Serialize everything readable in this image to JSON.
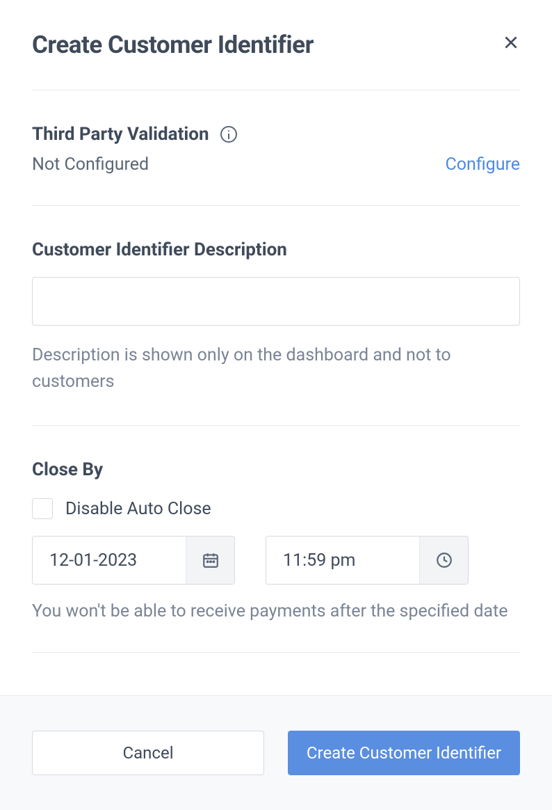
{
  "header": {
    "title": "Create Customer Identifier"
  },
  "validation": {
    "label": "Third Party Validation",
    "status": "Not Configured",
    "configure_link": "Configure"
  },
  "description": {
    "label": "Customer Identifier Description",
    "value": "",
    "helper": "Description is shown only on the dashboard and not to customers"
  },
  "close_by": {
    "label": "Close By",
    "checkbox_label": "Disable Auto Close",
    "date_value": "12-01-2023",
    "time_value": "11:59 pm",
    "helper": "You won't be able to receive payments after the specified date"
  },
  "footer": {
    "cancel_label": "Cancel",
    "submit_label": "Create Customer Identifier"
  }
}
